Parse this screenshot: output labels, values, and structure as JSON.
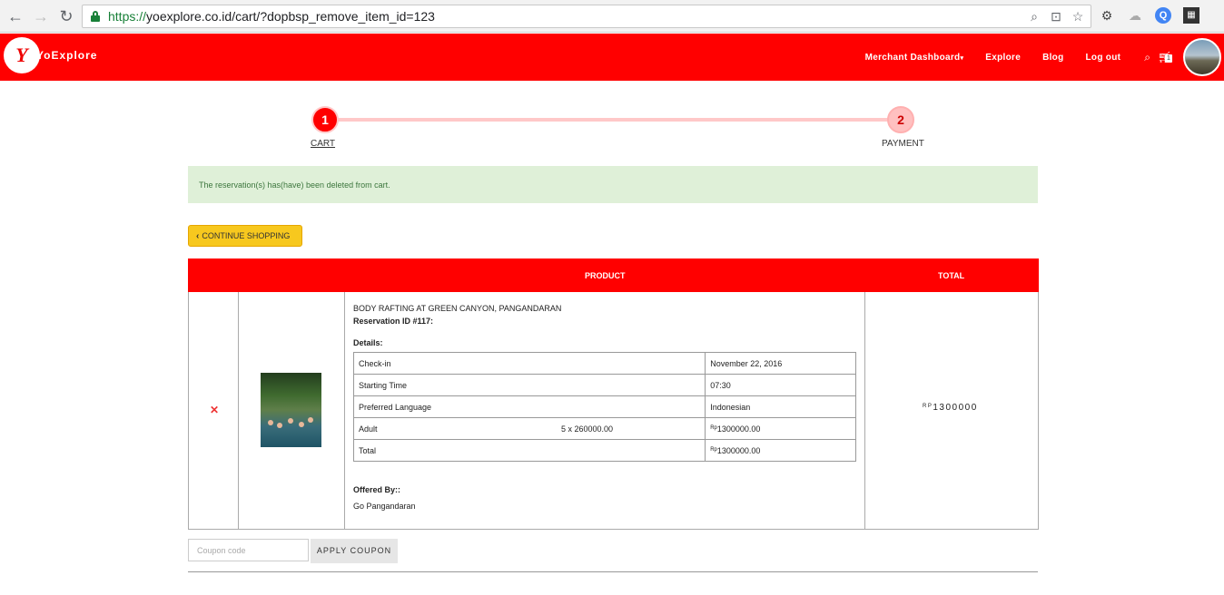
{
  "browser": {
    "url_scheme": "https://",
    "url_rest": "yoexplore.co.id/cart/?dopbsp_remove_item_id=123"
  },
  "header": {
    "logo_text": "YoExplore",
    "nav": [
      "Merchant Dashboard",
      "Explore",
      "Blog",
      "Log out"
    ],
    "cart_count": "1",
    "brand_color": "#ff0000"
  },
  "steps": [
    {
      "number": "1",
      "label": "CART"
    },
    {
      "number": "2",
      "label": "PAYMENT"
    }
  ],
  "alert": {
    "message": "The reservation(s) has(have) been deleted from cart."
  },
  "continue_label": "CONTINUE SHOPPING",
  "table": {
    "headers": {
      "product": "PRODUCT",
      "total": "TOTAL"
    },
    "item": {
      "title": "BODY RAFTING AT GREEN CANYON, PANGANDARAN",
      "reservation_id": "Reservation ID #117:",
      "details_label": "Details:",
      "details": [
        {
          "label": "Check-in",
          "value": "November 22, 2016"
        },
        {
          "label": "Starting Time",
          "value": "07:30"
        },
        {
          "label": "Preferred Language",
          "value": "Indonesian"
        },
        {
          "label": "Adult",
          "qty": "5 x 260000.00",
          "currency": "Rp",
          "value": "1300000.00"
        },
        {
          "label": "Total",
          "currency": "Rp",
          "value": "1300000.00"
        }
      ],
      "offered_by_label": "Offered By::",
      "offered_by": "Go Pangandaran",
      "total_currency": "RP",
      "total_value": "1300000"
    }
  },
  "coupon": {
    "placeholder": "Coupon code",
    "button_label": "APPLY COUPON"
  }
}
